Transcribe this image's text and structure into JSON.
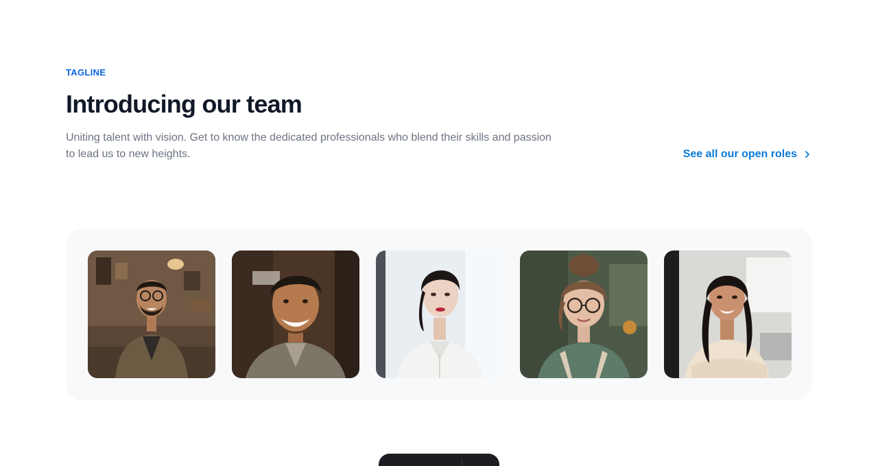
{
  "header": {
    "tagline": "TAGLINE",
    "title": "Introducing our team",
    "description": "Uniting talent with vision. Get to know the dedicated professionals who blend their skills and passion to lead us to new heights.",
    "roles_link": "See all our open roles",
    "roles_icon": "chevron-right-icon"
  },
  "colors": {
    "accent": "#0b66e4",
    "link": "#0b7ad8",
    "heading": "#111827",
    "muted": "#6b7280",
    "card_bg": "#f8f9fb"
  },
  "team": {
    "members": [
      {
        "photo": "man-glasses-jacket-portrait"
      },
      {
        "photo": "smiling-man-portrait"
      },
      {
        "photo": "woman-white-shirt-portrait"
      },
      {
        "photo": "woman-glasses-bun-portrait"
      },
      {
        "photo": "woman-arms-crossed-portrait"
      }
    ]
  },
  "dock": {
    "icons": [
      "mic-icon",
      "brush-icon",
      "menu-icon",
      "settings-icon"
    ]
  }
}
